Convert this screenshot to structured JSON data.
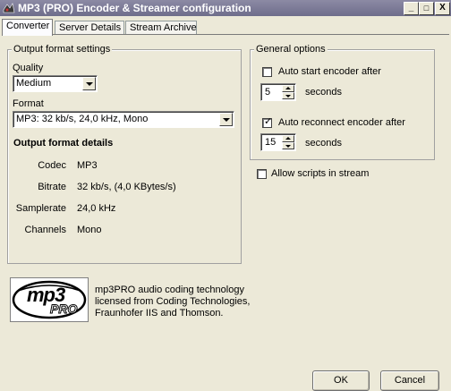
{
  "window": {
    "title": "MP3 (PRO) Encoder & Streamer configuration",
    "controls": {
      "minimize": "_",
      "maximize": "□",
      "close": "X"
    }
  },
  "tabs": [
    {
      "label": "Converter",
      "active": true
    },
    {
      "label": "Server Details",
      "active": false
    },
    {
      "label": "Stream Archive",
      "active": false
    }
  ],
  "output_settings": {
    "legend": "Output format settings",
    "quality_label": "Quality",
    "quality_value": "Medium",
    "format_label": "Format",
    "format_value": "MP3: 32 kb/s, 24,0 kHz, Mono",
    "details_heading": "Output format details",
    "details": [
      {
        "label": "Codec",
        "value": "MP3"
      },
      {
        "label": "Bitrate",
        "value": "32 kb/s, (4,0 KBytes/s)"
      },
      {
        "label": "Samplerate",
        "value": "24,0 kHz"
      },
      {
        "label": "Channels",
        "value": "Mono"
      }
    ]
  },
  "general_options": {
    "legend": "General options",
    "auto_start_label": "Auto start encoder after",
    "auto_start_checked": false,
    "auto_start_value": "5",
    "auto_start_unit": "seconds",
    "auto_reconnect_label": "Auto reconnect encoder after",
    "auto_reconnect_checked": true,
    "auto_reconnect_value": "15",
    "auto_reconnect_unit": "seconds"
  },
  "allow_scripts_label": "Allow scripts in stream",
  "allow_scripts_checked": false,
  "logo": {
    "text_main": "mp3",
    "text_sub": "PRO"
  },
  "credits": "mp3PRO audio coding technology licensed from Coding Technologies, Fraunhofer IIS and Thomson.",
  "buttons": {
    "ok": "OK",
    "cancel": "Cancel"
  },
  "icons": {
    "app": "winamp-icon",
    "dropdown": "chevron-down-icon",
    "check": "checkmark-icon"
  },
  "colors": {
    "titlebar": "#7d7b99",
    "dialog": "#ece9d8"
  }
}
